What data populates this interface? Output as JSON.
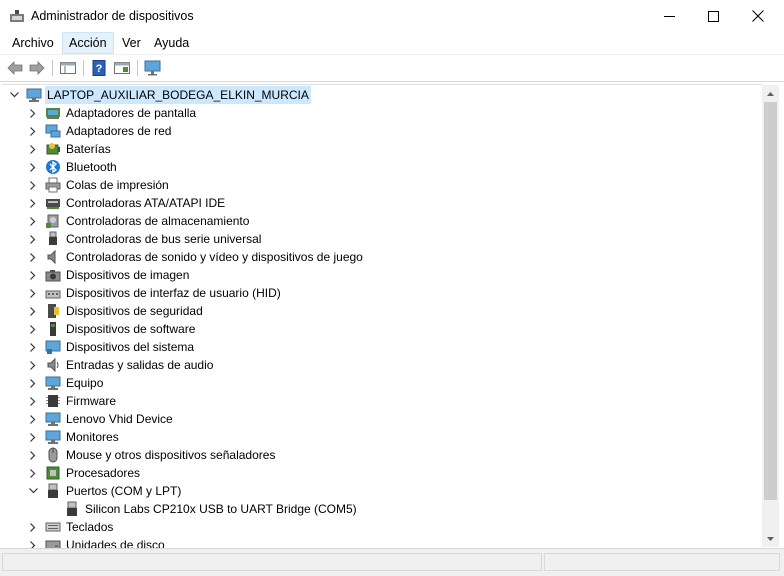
{
  "window": {
    "title": "Administrador de dispositivos"
  },
  "menu": [
    "Archivo",
    "Acción",
    "Ver",
    "Ayuda"
  ],
  "tree": {
    "root": "LAPTOP_AUXILIAR_BODEGA_ELKIN_MURCIA",
    "items": [
      {
        "label": "Adaptadores de pantalla",
        "icon": "display-adapter-icon",
        "expanded": false
      },
      {
        "label": "Adaptadores de red",
        "icon": "network-adapter-icon",
        "expanded": false
      },
      {
        "label": "Baterías",
        "icon": "battery-icon",
        "expanded": false
      },
      {
        "label": "Bluetooth",
        "icon": "bluetooth-icon",
        "expanded": false
      },
      {
        "label": "Colas de impresión",
        "icon": "printer-icon",
        "expanded": false
      },
      {
        "label": "Controladoras ATA/ATAPI IDE",
        "icon": "ide-controller-icon",
        "expanded": false
      },
      {
        "label": "Controladoras de almacenamiento",
        "icon": "storage-controller-icon",
        "expanded": false
      },
      {
        "label": "Controladoras de bus serie universal",
        "icon": "usb-icon",
        "expanded": false
      },
      {
        "label": "Controladoras de sonido y vídeo y dispositivos de juego",
        "icon": "speaker-icon",
        "expanded": false
      },
      {
        "label": "Dispositivos de imagen",
        "icon": "camera-icon",
        "expanded": false
      },
      {
        "label": "Dispositivos de interfaz de usuario (HID)",
        "icon": "hid-icon",
        "expanded": false
      },
      {
        "label": "Dispositivos de seguridad",
        "icon": "security-key-icon",
        "expanded": false
      },
      {
        "label": "Dispositivos de software",
        "icon": "software-device-icon",
        "expanded": false
      },
      {
        "label": "Dispositivos del sistema",
        "icon": "system-device-icon",
        "expanded": false
      },
      {
        "label": "Entradas y salidas de audio",
        "icon": "audio-io-icon",
        "expanded": false
      },
      {
        "label": "Equipo",
        "icon": "computer-icon",
        "expanded": false
      },
      {
        "label": "Firmware",
        "icon": "firmware-icon",
        "expanded": false
      },
      {
        "label": "Lenovo Vhid Device",
        "icon": "monitor-icon",
        "expanded": false
      },
      {
        "label": "Monitores",
        "icon": "monitor-icon",
        "expanded": false
      },
      {
        "label": "Mouse y otros dispositivos señaladores",
        "icon": "mouse-icon",
        "expanded": false
      },
      {
        "label": "Procesadores",
        "icon": "processor-icon",
        "expanded": false
      },
      {
        "label": "Puertos (COM y LPT)",
        "icon": "port-icon",
        "expanded": true,
        "children": [
          "Silicon Labs CP210x USB to UART Bridge (COM5)"
        ]
      },
      {
        "label": "Teclados",
        "icon": "keyboard-icon",
        "expanded": false
      },
      {
        "label": "Unidades de disco",
        "icon": "disk-drive-icon",
        "expanded": false
      }
    ]
  },
  "colors": {
    "selection": "#cce8ff",
    "menu_active": "#e5f1fb",
    "scroll_thumb": "#cdcdcd"
  }
}
